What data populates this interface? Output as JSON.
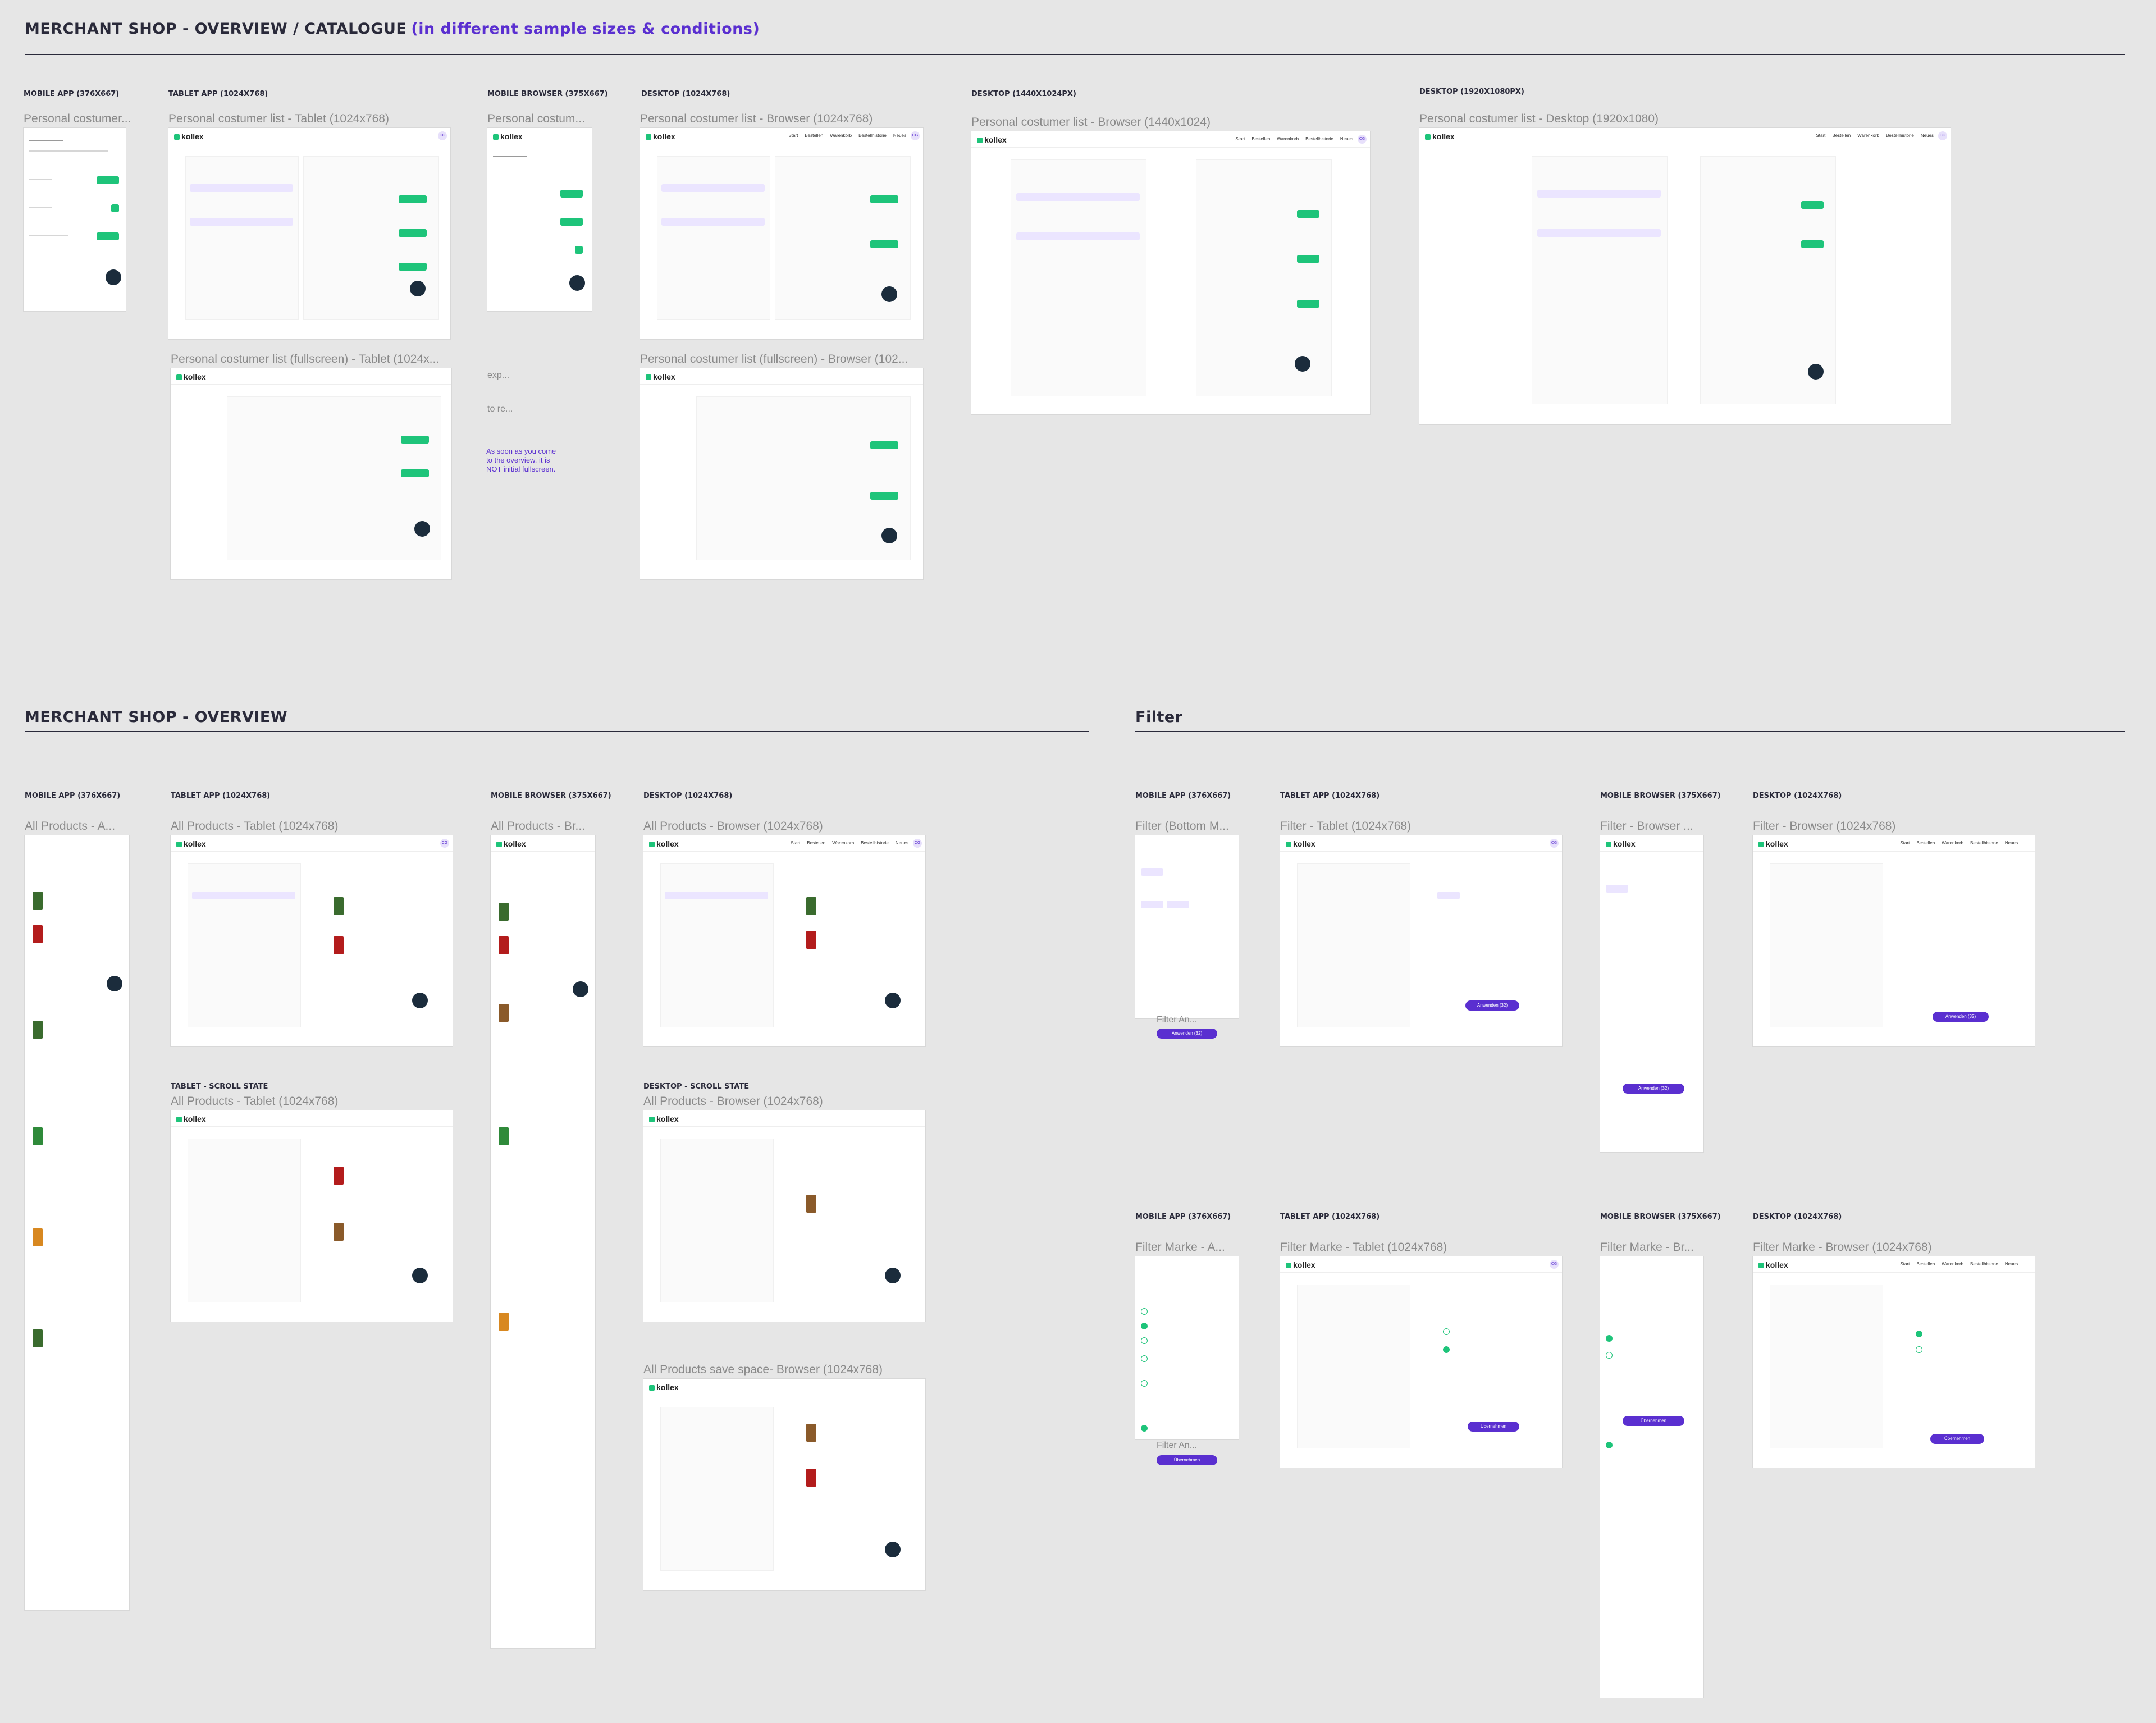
{
  "sections": {
    "catalogue": {
      "title": "MERCHANT SHOP - OVERVIEW / CATALOGUE",
      "subtitle": "(in different sample sizes & conditions)"
    },
    "overview": {
      "title": "MERCHANT SHOP - OVERVIEW"
    },
    "filter": {
      "title": "Filter"
    }
  },
  "labels": {
    "mobile_app": "MOBILE APP (376X667)",
    "tablet_app": "TABLET APP (1024X768)",
    "mobile_browser": "MOBILE BROWSER (375X667)",
    "desktop": "DESKTOP (1024X768)",
    "desktop_1440": "DESKTOP (1440X1024PX)",
    "desktop_1920": "DESKTOP (1920X1080PX)",
    "tablet_scroll": "TABLET - SCROLL STATE",
    "desktop_scroll": "DESKTOP - SCROLL STATE"
  },
  "frames": {
    "c1": "Personal costumer...",
    "c2": "Personal costumer list - Tablet (1024x768)",
    "c3": "Personal costum...",
    "c4": "Personal costumer list - Browser (1024x768)",
    "c5": "Personal costumer list - Browser (1440x1024)",
    "c6": "Personal costumer list - Desktop (1920x1080)",
    "c7": "Personal costumer list (fullscreen) - Tablet (1024x...",
    "c8": "Personal costumer list (fullscreen) - Browser (102...",
    "o1": "All Products - A...",
    "o2": "All Products - Tablet (1024x768)",
    "o3": "All Products - Br...",
    "o4": "All Products - Browser (1024x768)",
    "o5": "All Products - Tablet (1024x768)",
    "o6": "All Products - Browser (1024x768)",
    "o7": "All Products save space- Browser (1024x768)",
    "f1": "Filter (Bottom M...",
    "f2": "Filter - Tablet (1024x768)",
    "f3": "Filter - Browser ...",
    "f4": "Filter - Browser (1024x768)",
    "f5": "Filter Marke - A...",
    "f6": "Filter Marke - Tablet (1024x768)",
    "f7": "Filter Marke - Br...",
    "f8": "Filter Marke - Browser (1024x768)"
  },
  "notes": {
    "exp": "exp...",
    "tore": "to re...",
    "body": "As soon as you come to the overview, it is NOT initial fullscreen."
  },
  "ui": {
    "logo": "kollex",
    "nav": [
      "Start",
      "Bestellen",
      "Warenkorb",
      "Bestellhistorie",
      "Neues"
    ],
    "avatar": "CG",
    "apply": "Anwenden (32)",
    "accept": "Übernehmen",
    "filter_an": "Filter An..."
  },
  "colors": {
    "accent": "#5a2fd0",
    "green": "#1ec47a",
    "navy": "#1b2c3c"
  }
}
